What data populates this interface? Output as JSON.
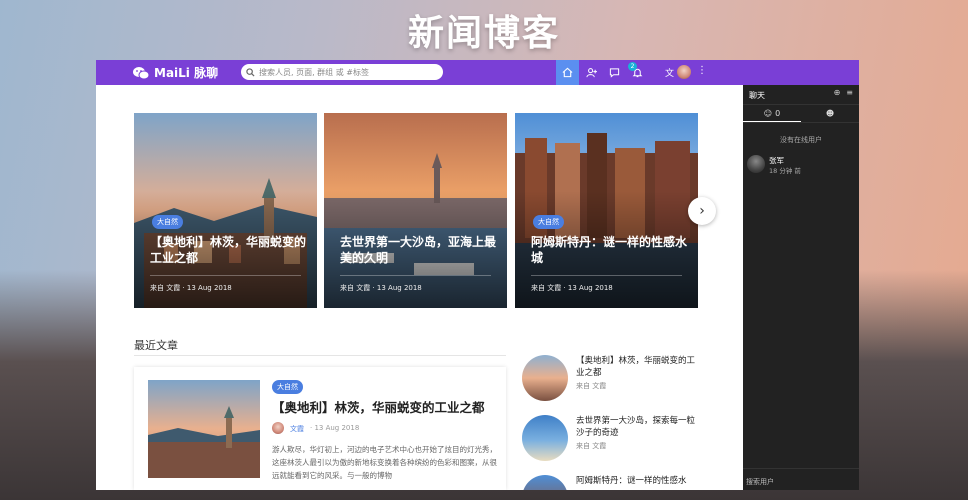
{
  "banner": {
    "title": "新闻博客"
  },
  "topbar": {
    "logo": "MaiLi 脉聊",
    "search_placeholder": "搜索人员, 页面, 群组 或 #标签",
    "notification_count": "2",
    "lang": "文",
    "accent": "#7a3fd6"
  },
  "featured": [
    {
      "tag": "大自然",
      "title": "【奥地利】林茨，华丽蜕变的工业之都",
      "author": "来自 文霞",
      "date": "13 Aug 2018"
    },
    {
      "tag": "",
      "title": "去世界第一大沙岛，亚海上最美的久明",
      "author": "来自 文霞",
      "date": "13 Aug 2018"
    },
    {
      "tag": "大自然",
      "title": "阿姆斯特丹：谜一样的性感水城",
      "author": "来自 文霞",
      "date": "13 Aug 2018"
    }
  ],
  "recent": {
    "heading": "最近文章",
    "main": {
      "tag": "大自然",
      "title": "【奥地利】林茨，华丽蜕变的工业之都",
      "author": "文霞",
      "date": "13 Aug 2018",
      "excerpt": "游人欺尽，华灯初上，河边的电子艺术中心也开始了炫目的灯光秀，这座林茨人最引以为傲的新地标变换着各种缤纷的色彩和图案，从很远就能看到它的风采。与一般的博物"
    },
    "list": [
      {
        "title": "【奥地利】林茨，华丽蜕变的工业之都",
        "meta": "来自 文霞"
      },
      {
        "title": "去世界第一大沙岛，探索每一粒沙子的奇迹",
        "meta": "来自 文霞"
      },
      {
        "title": "阿姆斯特丹：谜一样的性感水",
        "meta": ""
      }
    ]
  },
  "sidebar": {
    "title": "聊天",
    "tab_online_count": "0",
    "no_online": "没有在线用户",
    "friend": {
      "name": "张军",
      "time": "18 分钟 前"
    },
    "search_placeholder": "搜索用户"
  }
}
